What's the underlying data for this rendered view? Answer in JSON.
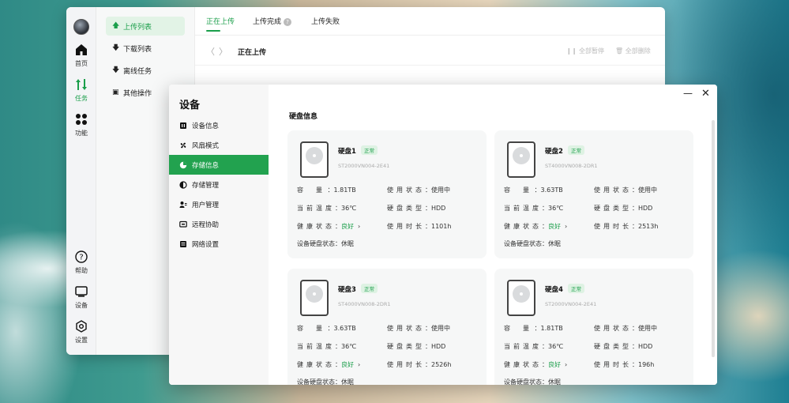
{
  "main_window": {
    "nav_rail": [
      {
        "id": "home",
        "label": "首页",
        "icon": "home-icon"
      },
      {
        "id": "tasks",
        "label": "任务",
        "icon": "transfer-icon",
        "active": true
      },
      {
        "id": "functions",
        "label": "功能",
        "icon": "grid-icon"
      },
      {
        "id": "help",
        "label": "帮助",
        "icon": "help-icon"
      },
      {
        "id": "device",
        "label": "设备",
        "icon": "monitor-icon"
      },
      {
        "id": "settings",
        "label": "设置",
        "icon": "gear-icon"
      }
    ],
    "sub_nav": [
      {
        "label": "上传列表",
        "arrow": "🡅",
        "active": true
      },
      {
        "label": "下载列表",
        "arrow": "🡇"
      },
      {
        "label": "离线任务",
        "arrow": "🡇"
      },
      {
        "label": "其他操作",
        "arrow": "▣"
      }
    ],
    "tabs": [
      "正在上传",
      "上传完成",
      "上传失败"
    ],
    "breadcrumb": "正在上传",
    "toolbar": {
      "pause_all": "全部暂停",
      "delete_all": "全部删除"
    }
  },
  "device_window": {
    "title": "设备",
    "menu": [
      {
        "label": "设备信息"
      },
      {
        "label": "风扇模式"
      },
      {
        "label": "存储信息",
        "active": true
      },
      {
        "label": "存储管理"
      },
      {
        "label": "用户管理"
      },
      {
        "label": "远程协助"
      },
      {
        "label": "网络设置"
      }
    ],
    "section_title": "硬盘信息",
    "labels": {
      "capacity": "容　量",
      "temp": "当前温度",
      "health": "健康状态",
      "status": "使用状态",
      "type": "硬盘类型",
      "hours": "使用时长",
      "sleep": "设备硬盘状态：休眠"
    },
    "disks": [
      {
        "name": "硬盘1",
        "badge": "正常",
        "model": "ST2000VN004-2E41",
        "capacity": "1.81TB",
        "temp": "36℃",
        "health": "良好",
        "status": "使用中",
        "type": "HDD",
        "hours": "1101h"
      },
      {
        "name": "硬盘2",
        "badge": "正常",
        "model": "ST4000VN008-2DR1",
        "capacity": "3.63TB",
        "temp": "36℃",
        "health": "良好",
        "status": "使用中",
        "type": "HDD",
        "hours": "2513h"
      },
      {
        "name": "硬盘3",
        "badge": "正常",
        "model": "ST4000VN008-2DR1",
        "capacity": "3.63TB",
        "temp": "36℃",
        "health": "良好",
        "status": "使用中",
        "type": "HDD",
        "hours": "2526h"
      },
      {
        "name": "硬盘4",
        "badge": "正常",
        "model": "ST2000VN004-2E41",
        "capacity": "1.81TB",
        "temp": "36℃",
        "health": "良好",
        "status": "使用中",
        "type": "HDD",
        "hours": "196h"
      }
    ]
  }
}
